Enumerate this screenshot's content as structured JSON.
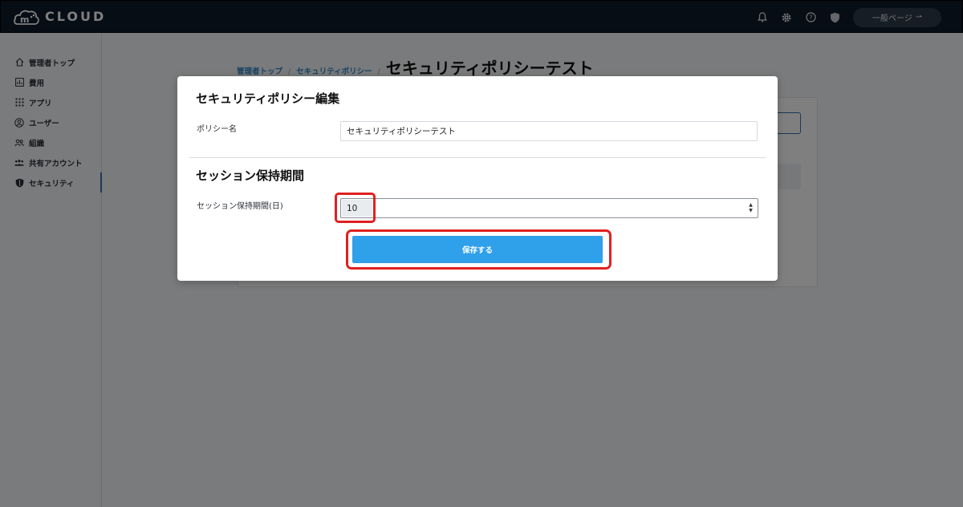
{
  "header": {
    "logo_text": "CLOUD",
    "logo_mark": "m",
    "general_page_label": "一般ページ",
    "general_page_arrow": "⇀",
    "icons": [
      "bell-icon",
      "gear-icon",
      "help-icon",
      "shield-icon"
    ]
  },
  "sidebar": {
    "items": [
      {
        "label": "管理者トップ",
        "icon": "home-icon"
      },
      {
        "label": "費用",
        "icon": "chart-icon"
      },
      {
        "label": "アプリ",
        "icon": "apps-grid-icon"
      },
      {
        "label": "ユーザー",
        "icon": "user-icon"
      },
      {
        "label": "組織",
        "icon": "group-icon"
      },
      {
        "label": "共有アカウント",
        "icon": "shared-account-icon"
      },
      {
        "label": "セキュリティ",
        "icon": "shield-icon",
        "active": true
      }
    ]
  },
  "breadcrumb": {
    "items": [
      "管理者トップ",
      "セキュリティポリシー"
    ],
    "separator": "/",
    "current": "セキュリティポリシーテスト"
  },
  "modal": {
    "title": "セキュリティポリシー編集",
    "policy_name_label": "ポリシー名",
    "policy_name_value": "セキュリティポリシーテスト",
    "section_title": "セッション保持期間",
    "session_label": "セッション保持期間(日)",
    "session_value": "10",
    "save_label": "保存する"
  },
  "colors": {
    "header_bg": "#0d1b2a",
    "accent": "#2fa0ea",
    "highlight": "#e02020",
    "link": "#2f86c9"
  }
}
